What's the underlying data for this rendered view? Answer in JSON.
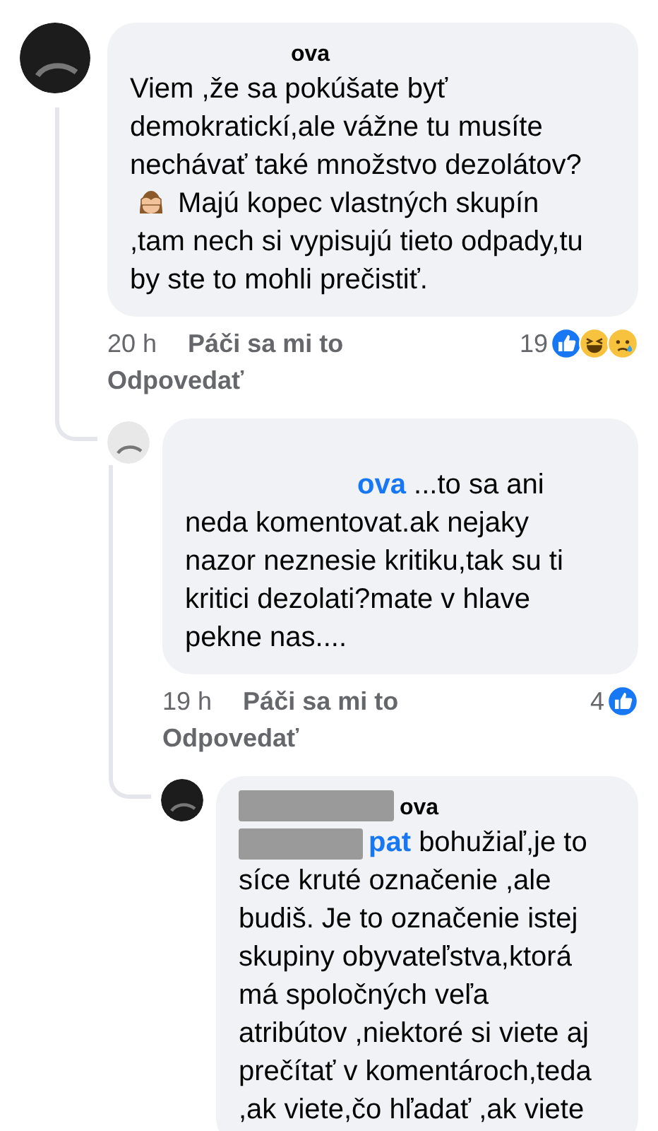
{
  "comments": [
    {
      "author": "ova",
      "redacted": false,
      "segments": [
        {
          "kind": "text",
          "text": "Viem ,že sa pokúšate byť demokratickí,ale vážne tu musíte nechávať také množstvo dezolátov?"
        },
        {
          "kind": "monkey"
        },
        {
          "kind": "text",
          "text": "Majú kopec vlastných skupín ,tam nech si vypisujú tieto odpady,tu by ste to mohli prečistiť."
        }
      ],
      "time": "20 h",
      "like_label": "Páči sa mi to",
      "reply_label": "Odpovedať",
      "reaction_count": "19",
      "reactions": [
        {
          "kind": "like"
        },
        {
          "kind": "haha"
        },
        {
          "kind": "sad"
        }
      ],
      "children": [
        {
          "redacted": false,
          "mention": "ova",
          "segments": [
            {
              "kind": "lead",
              "text": "...to sa ani"
            },
            {
              "kind": "text",
              "text": "neda komentovat.ak nejaky nazor neznesie kritiku,tak su ti kritici dezolati?mate v hlave pekne nas...."
            }
          ],
          "time": "19 h",
          "like_label": "Páči sa mi to",
          "reply_label": "Odpovedať",
          "reaction_count": "4",
          "reactions": [
            {
              "kind": "like"
            }
          ],
          "children": [
            {
              "author": "ova",
              "redacted": true,
              "mention": "pat",
              "segments": [
                {
                  "kind": "lead",
                  "text": "bohužiaľ,je to"
                },
                {
                  "kind": "text",
                  "text": "síce kruté označenie ,ale budiš. Je to označenie istej skupiny obyvateľstva,ktorá má spoločných veľa atribútov ,niektoré si viete aj prečítať v komentároch,teda ,ak viete,čo hľadať ,ak viete"
                }
              ]
            }
          ]
        }
      ]
    }
  ]
}
